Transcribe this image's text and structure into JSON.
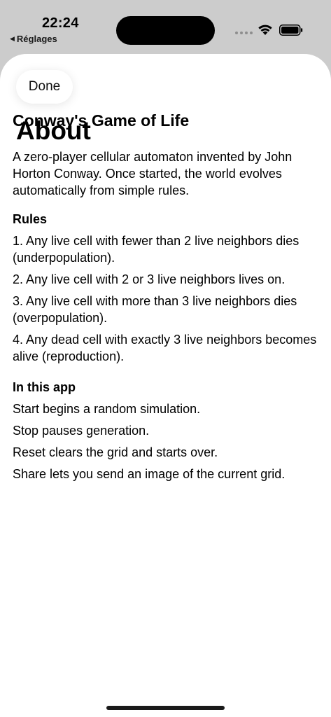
{
  "status_bar": {
    "time": "22:24",
    "back_app": "Réglages",
    "back_glyph": "◀"
  },
  "sheet": {
    "done_label": "Done",
    "title": "About"
  },
  "content": {
    "heading": "Conway's Game of Life",
    "intro": "A zero-player cellular automaton invented by John Horton Conway. Once started, the world evolves automatically from simple rules.",
    "rules_title": "Rules",
    "rules": [
      "1. Any live cell with fewer than 2 live neighbors dies (underpopulation).",
      "2. Any live cell with 2 or 3 live neighbors lives on.",
      "3. Any live cell with more than 3 live neighbors dies (overpopulation).",
      "4. Any dead cell with exactly 3 live neighbors becomes alive (reproduction)."
    ],
    "app_title": "In this app",
    "app_items": [
      "Start begins a random simulation.",
      "Stop pauses generation.",
      "Reset clears the grid and starts over.",
      "Share lets you send an image of the current grid."
    ]
  }
}
